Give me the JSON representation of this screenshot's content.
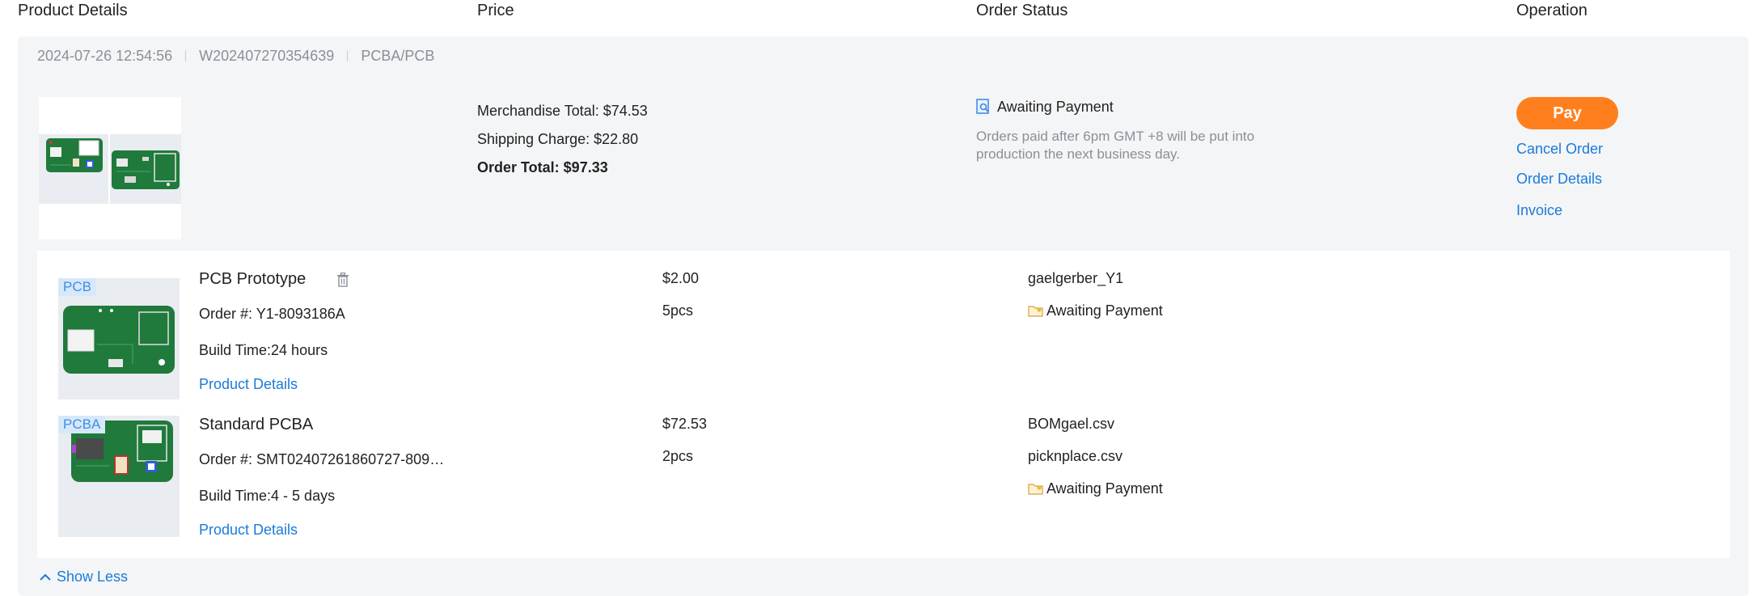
{
  "columns": {
    "product": "Product Details",
    "price": "Price",
    "status": "Order Status",
    "operation": "Operation"
  },
  "order": {
    "date": "2024-07-26 12:54:56",
    "number": "W202407270354639",
    "type": "PCBA/PCB",
    "merchandise_total": "Merchandise Total: $74.53",
    "shipping_charge": "Shipping Charge: $22.80",
    "order_total": "Order Total: $97.33",
    "status": "Awaiting Payment",
    "status_note": "Orders paid after 6pm GMT +8 will be put into production the next business day.",
    "actions": {
      "pay": "Pay",
      "cancel": "Cancel Order",
      "details": "Order Details",
      "invoice": "Invoice"
    }
  },
  "items": [
    {
      "tag": "PCB",
      "name": "PCB Prototype",
      "order_no": "Order #: Y1-8093186A",
      "build_time": "Build Time:24 hours",
      "link": "Product Details",
      "price": "$2.00",
      "qty": "5pcs",
      "files": [
        "gaelgerber_Y1"
      ],
      "status": "Awaiting Payment"
    },
    {
      "tag": "PCBA",
      "name": "Standard PCBA",
      "order_no": "Order #: SMT02407261860727-809…",
      "build_time": "Build Time:4 - 5 days",
      "link": "Product Details",
      "price": "$72.53",
      "qty": "2pcs",
      "files": [
        "BOMgael.csv",
        "picknplace.csv"
      ],
      "status": "Awaiting Payment"
    }
  ],
  "show_less": "Show Less",
  "icons": {
    "status": "order-search-icon",
    "item_status": "folder-icon",
    "delete": "trash-icon",
    "toggle": "chevron-up-icon"
  },
  "colors": {
    "accent": "#1a7bd9",
    "pay": "#ff7f1e",
    "board": "#1f7a3c",
    "tag_bg": "#d7e8fb"
  }
}
